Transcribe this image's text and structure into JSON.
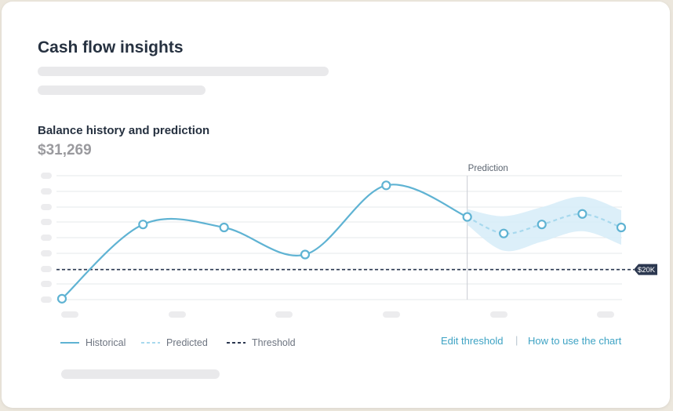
{
  "card": {
    "title": "Cash flow insights",
    "subtitle": "Balance history and prediction",
    "balance": "$31,269"
  },
  "chart_data": {
    "type": "line",
    "title": "Balance history and prediction",
    "annotation": "Prediction",
    "threshold_label": "$20K",
    "x_tick_labels_visible": false,
    "y_tick_labels_visible": false,
    "grid": true,
    "legend": "bottom-left",
    "series": [
      {
        "name": "Historical",
        "style": "solid",
        "color": "#5fb3d3",
        "x": [
          0,
          1,
          2,
          3,
          4,
          5
        ],
        "values": [
          10.3,
          35,
          34,
          25,
          48,
          37.5
        ]
      },
      {
        "name": "Predicted",
        "style": "dashed",
        "color": "#a8d9ee",
        "x": [
          5,
          5.45,
          5.92,
          6.42,
          6.9
        ],
        "values": [
          37.5,
          32,
          35,
          38.5,
          34
        ]
      },
      {
        "name": "Threshold",
        "style": "dashed",
        "color": "#2c3850",
        "value": 20
      }
    ],
    "prediction_start_x": 5,
    "ylim": [
      10,
      52
    ],
    "xlim": [
      0,
      6.9
    ]
  },
  "legend": {
    "historical": "Historical",
    "predicted": "Predicted",
    "threshold": "Threshold"
  },
  "actions": {
    "edit_threshold": "Edit threshold",
    "separator": "|",
    "how_to": "How to use the chart"
  },
  "colors": {
    "historical": "#5fb3d3",
    "predicted": "#a8d9ee",
    "band": "#d6ecf8",
    "threshold": "#2c3850",
    "link": "#3ea3c4"
  }
}
